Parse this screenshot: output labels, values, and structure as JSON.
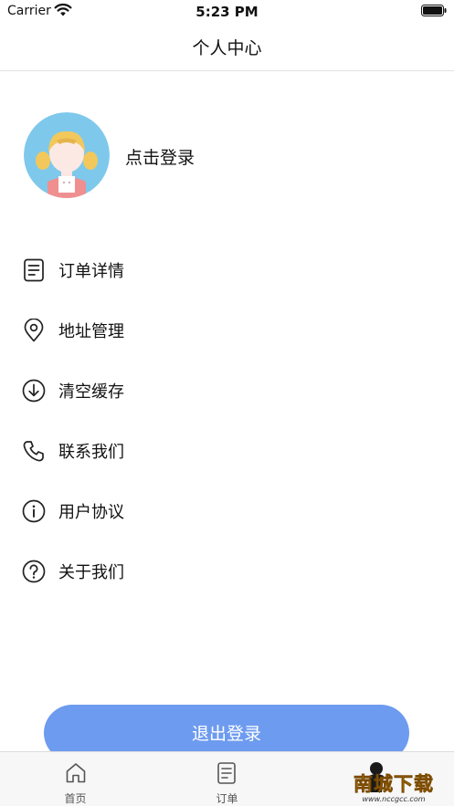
{
  "status_bar": {
    "carrier": "Carrier",
    "time": "5:23 PM"
  },
  "nav": {
    "title": "个人中心"
  },
  "profile": {
    "login_label": "点击登录"
  },
  "menu": [
    {
      "label": "订单详情",
      "icon": "document-icon"
    },
    {
      "label": "地址管理",
      "icon": "location-pin-icon"
    },
    {
      "label": "清空缓存",
      "icon": "download-circle-icon"
    },
    {
      "label": "联系我们",
      "icon": "phone-icon"
    },
    {
      "label": "用户协议",
      "icon": "info-icon"
    },
    {
      "label": "关于我们",
      "icon": "question-icon"
    }
  ],
  "logout": {
    "label": "退出登录"
  },
  "tabs": [
    {
      "label": "首页",
      "icon": "home-icon"
    },
    {
      "label": "订单",
      "icon": "order-document-icon"
    }
  ],
  "colors": {
    "accent": "#6d9bef",
    "avatar_bg": "#7ec8ec",
    "tab_bar_bg": "#f7f7f7"
  },
  "watermark": {
    "brand": "南城下载",
    "url": "www.nccgcc.com"
  }
}
